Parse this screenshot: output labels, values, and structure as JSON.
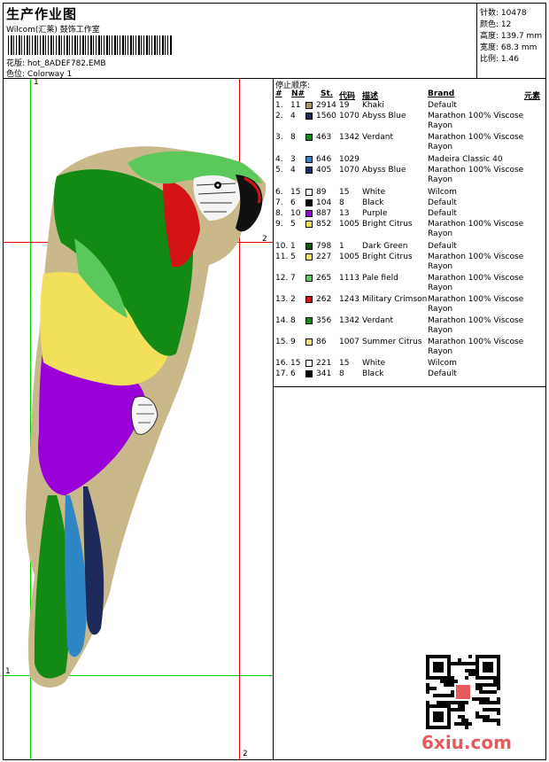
{
  "header": {
    "title": "生产作业图",
    "company": "Wilcom(汇莱) 鼓饰工作室",
    "design_label": "花版:",
    "design_value": "hot_8ADEF782.EMB",
    "colorway_label": "色位:",
    "colorway_value": "Colorway 1"
  },
  "info": {
    "stitches_label": "针数:",
    "stitches": "10478",
    "colors_label": "颜色:",
    "colors": "12",
    "height_label": "高度:",
    "height": "139.7 mm",
    "width_label": "宽度:",
    "width": "68.3 mm",
    "scale_label": "比例:",
    "scale": "1.46"
  },
  "guides": {
    "v1": "1",
    "h1": "1",
    "v2": "2",
    "h2": "2"
  },
  "table": {
    "stop_label": "停止顺序:",
    "headers": {
      "num": "#",
      "n": "N#",
      "st": "St.",
      "code": "代码",
      "desc": "描述",
      "brand": "Brand",
      "element": "元素"
    },
    "rows": [
      {
        "idx": "1.",
        "n": "11",
        "color": "#a89a6a",
        "st": "2914",
        "code": "19",
        "desc": "Khaki",
        "brand": "Default"
      },
      {
        "idx": "2.",
        "n": "4",
        "color": "#1e2a5a",
        "st": "1560",
        "code": "1070",
        "desc": "Abyss Blue",
        "brand": "Marathon 100% Viscose Rayon"
      },
      {
        "idx": "3.",
        "n": "8",
        "color": "#138a13",
        "st": "463",
        "code": "1342",
        "desc": "Verdant",
        "brand": "Marathon 100% Viscose Rayon"
      },
      {
        "idx": "4.",
        "n": "3",
        "color": "#2f86c7",
        "st": "646",
        "code": "1029",
        "desc": "",
        "brand": "Madeira Classic 40"
      },
      {
        "idx": "5.",
        "n": "4",
        "color": "#1e2a5a",
        "st": "405",
        "code": "1070",
        "desc": "Abyss Blue",
        "brand": "Marathon 100% Viscose Rayon"
      },
      {
        "idx": "6.",
        "n": "15",
        "color": "#ffffff",
        "st": "89",
        "code": "15",
        "desc": "White",
        "brand": "Wilcom"
      },
      {
        "idx": "7.",
        "n": "6",
        "color": "#000000",
        "st": "104",
        "code": "8",
        "desc": "Black",
        "brand": "Default"
      },
      {
        "idx": "8.",
        "n": "10",
        "color": "#9a00d8",
        "st": "887",
        "code": "13",
        "desc": "Purple",
        "brand": "Default"
      },
      {
        "idx": "9.",
        "n": "5",
        "color": "#f2e05a",
        "st": "852",
        "code": "1005",
        "desc": "Bright Citrus",
        "brand": "Marathon 100% Viscose Rayon"
      },
      {
        "idx": "10.",
        "n": "1",
        "color": "#0a5a0a",
        "st": "798",
        "code": "1",
        "desc": "Dark Green",
        "brand": "Default"
      },
      {
        "idx": "11.",
        "n": "5",
        "color": "#f2e05a",
        "st": "227",
        "code": "1005",
        "desc": "Bright Citrus",
        "brand": "Marathon 100% Viscose Rayon"
      },
      {
        "idx": "12.",
        "n": "7",
        "color": "#5ac85a",
        "st": "265",
        "code": "1113",
        "desc": "Pale field",
        "brand": "Marathon 100% Viscose Rayon"
      },
      {
        "idx": "13.",
        "n": "2",
        "color": "#d41414",
        "st": "262",
        "code": "1243",
        "desc": "Military Crimson",
        "brand": "Marathon 100% Viscose Rayon"
      },
      {
        "idx": "14.",
        "n": "8",
        "color": "#138a13",
        "st": "356",
        "code": "1342",
        "desc": "Verdant",
        "brand": "Marathon 100% Viscose Rayon"
      },
      {
        "idx": "15.",
        "n": "9",
        "color": "#f7e07a",
        "st": "86",
        "code": "1007",
        "desc": "Summer Citrus",
        "brand": "Marathon 100% Viscose Rayon"
      },
      {
        "idx": "16.",
        "n": "15",
        "color": "#ffffff",
        "st": "221",
        "code": "15",
        "desc": "White",
        "brand": "Wilcom"
      },
      {
        "idx": "17.",
        "n": "6",
        "color": "#000000",
        "st": "341",
        "code": "8",
        "desc": "Black",
        "brand": "Default"
      }
    ]
  },
  "watermark": "6xiu.com",
  "colors": {
    "guide_green": "#00d000",
    "guide_red": "#e00000"
  }
}
